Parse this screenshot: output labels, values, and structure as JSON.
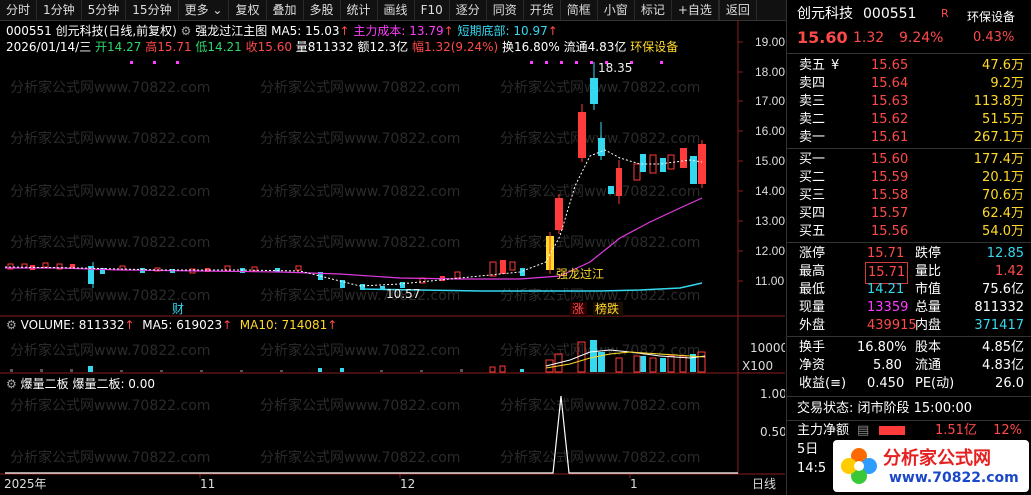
{
  "toolbar": {
    "items": [
      "分时",
      "1分钟",
      "5分钟",
      "15分钟",
      "更多",
      "复权",
      "叠加",
      "多股",
      "统计",
      "画线",
      "F10",
      "逐分",
      "同资",
      "开货",
      "简框",
      "小窗",
      "标记",
      "+自选",
      "返回"
    ],
    "more_arrow": "⌄"
  },
  "main_header": {
    "code": "000551",
    "name": "创元科技",
    "period": "(日线,前复权)",
    "indicator": "强龙过江主图",
    "ma5": "MA5: 15.03",
    "main_cost": "主力成本: 13.79",
    "short_bottom": "短期底部: 10.97",
    "line2": {
      "date": "2026/01/14/三",
      "open": "开14.27",
      "high": "高15.71",
      "low": "低14.21",
      "close": "收15.60",
      "vol": "量811332",
      "amount": "额12.3亿",
      "chg": "幅1.32(9.24%)",
      "turnover": "换16.80%",
      "float": "流通4.83亿",
      "sector": "环保设备"
    }
  },
  "price_axis": [
    "19.00",
    "18.00",
    "17.00",
    "16.00",
    "15.00",
    "14.00",
    "13.00",
    "12.00",
    "11.00"
  ],
  "annotations": {
    "high_mark": "18.35",
    "low_mark": "10.57",
    "signal_label": "强龙过江",
    "cai_label": "财",
    "zhang_label": "涨",
    "bang_label": "榜跌"
  },
  "volume_header": {
    "vol": "VOLUME: 811332",
    "ma5": "MA5: 619023",
    "ma10": "MA10: 714081"
  },
  "volume_axis": {
    "top": "10000",
    "unit": "X100"
  },
  "sub_header": {
    "name": "爆量二板",
    "value": "爆量二板: 0.00"
  },
  "sub_axis": [
    "1.00",
    "0.50"
  ],
  "time_axis": [
    "2025年",
    "11",
    "12",
    "1",
    "日线"
  ],
  "watermark": "分析家公式网www.70822.com",
  "quote": {
    "name": "创元科技",
    "code": "000551",
    "flag": "R",
    "sector": "环保设备",
    "sector_chg": "0.43%",
    "price": "15.60",
    "change": "1.32",
    "pct": "9.24%",
    "asks": [
      {
        "label": "卖五",
        "flag": "¥",
        "price": "15.65",
        "vol": "47.6万"
      },
      {
        "label": "卖四",
        "flag": "",
        "price": "15.64",
        "vol": "9.2万"
      },
      {
        "label": "卖三",
        "flag": "",
        "price": "15.63",
        "vol": "113.8万"
      },
      {
        "label": "卖二",
        "flag": "",
        "price": "15.62",
        "vol": "51.5万"
      },
      {
        "label": "卖一",
        "flag": "",
        "price": "15.61",
        "vol": "267.1万"
      }
    ],
    "bids": [
      {
        "label": "买一",
        "price": "15.60",
        "vol": "177.4万"
      },
      {
        "label": "买二",
        "price": "15.59",
        "vol": "20.1万"
      },
      {
        "label": "买三",
        "price": "15.58",
        "vol": "70.6万"
      },
      {
        "label": "买四",
        "price": "15.57",
        "vol": "62.4万"
      },
      {
        "label": "买五",
        "price": "15.56",
        "vol": "54.0万"
      }
    ],
    "stats1": [
      {
        "l1": "涨停",
        "v1": "15.71",
        "l2": "跌停",
        "v2": "12.85"
      },
      {
        "l1": "最高",
        "v1": "15.71",
        "l2": "量比",
        "v2": "1.42"
      },
      {
        "l1": "最低",
        "v1": "14.21",
        "l2": "市值",
        "v2": "75.6亿"
      },
      {
        "l1": "现量",
        "v1": "13359",
        "l2": "总量",
        "v2": "811332"
      },
      {
        "l1": "外盘",
        "v1": "439915",
        "l2": "内盘",
        "v2": "371417"
      }
    ],
    "stats2": [
      {
        "l1": "换手",
        "v1": "16.80%",
        "l2": "股本",
        "v2": "4.85亿"
      },
      {
        "l1": "净资",
        "v1": "5.80",
        "l2": "流通",
        "v2": "4.83亿"
      },
      {
        "l1": "收益(≡)",
        "v1": "0.450",
        "l2": "PE(动)",
        "v2": "26.0"
      }
    ],
    "trade_status": "交易状态: 闭市阶段 15:00:00",
    "main_net_label": "主力净额",
    "main_net_value": "1.51亿",
    "main_net_pct": "12%",
    "tab_5d": "5日",
    "time_partial": "14:5",
    "logo_text": "分析家公式网",
    "logo_url": "www.70822.com"
  }
}
